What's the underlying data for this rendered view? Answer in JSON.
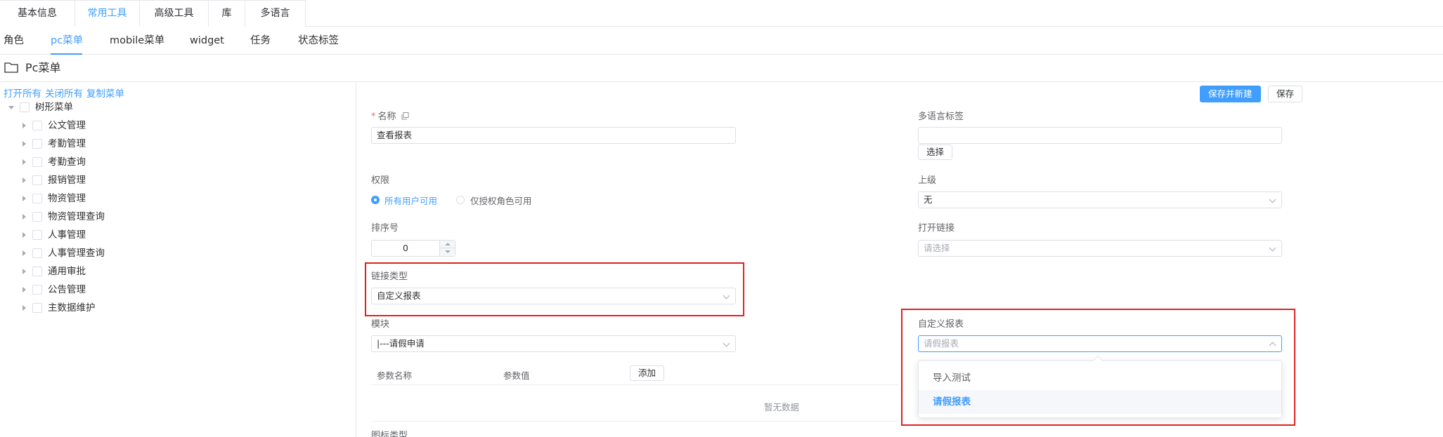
{
  "top_tabs": [
    "基本信息",
    "常用工具",
    "高级工具",
    "库",
    "多语言"
  ],
  "sub_tabs": [
    "角色",
    "pc菜单",
    "mobile菜单",
    "widget",
    "任务",
    "状态标签"
  ],
  "section_title": "Pc菜单",
  "tree_links": [
    "打开所有",
    "关闭所有",
    "复制菜单"
  ],
  "tree": {
    "root": "树形菜单",
    "children": [
      "公文管理",
      "考勤管理",
      "考勤查询",
      "报销管理",
      "物资管理",
      "物资管理查询",
      "人事管理",
      "人事管理查询",
      "通用审批",
      "公告管理",
      "主数据维护"
    ]
  },
  "buttons": {
    "save_new": "保存并新建",
    "save": "保存",
    "choose": "选择",
    "add": "添加"
  },
  "form": {
    "name_label": "名称",
    "name_value": "查看报表",
    "i18n_label": "多语言标签",
    "i18n_value": "",
    "permission_label": "权限",
    "permission_options": [
      "所有用户可用",
      "仅授权角色可用"
    ],
    "parent_label": "上级",
    "parent_value": "无",
    "order_label": "排序号",
    "order_value": "0",
    "open_link_label": "打开链接",
    "open_link_placeholder": "请选择",
    "link_type_label": "链接类型",
    "link_type_value": "自定义报表",
    "module_label": "模块",
    "module_value": "|---请假申请",
    "custom_report_label": "自定义报表",
    "custom_report_placeholder": "请假报表",
    "param_name_header": "参数名称",
    "param_value_header": "参数值",
    "empty_text": "暂无数据",
    "icon_type_label": "图标类型"
  },
  "custom_report_options": [
    "导入测试",
    "请假报表"
  ],
  "colors": {
    "primary": "#409eff",
    "highlight_box": "#e02020",
    "border": "#dcdfe6"
  }
}
